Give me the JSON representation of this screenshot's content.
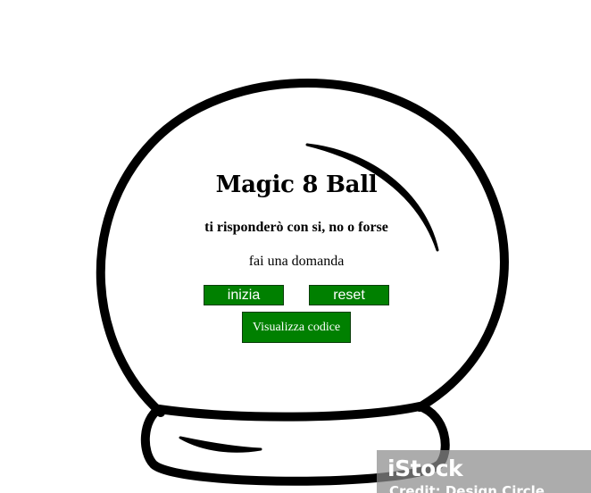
{
  "app": {
    "title": "Magic 8 Ball",
    "subtitle": "ti risponderò con si, no o forse",
    "prompt": "fai una domanda"
  },
  "buttons": {
    "start_label": "inizia",
    "reset_label": "reset",
    "view_code_label": "Visualizza codice"
  },
  "watermark": {
    "logo_text": "iStock",
    "credit_text": "Credit: Design Circle"
  },
  "colors": {
    "button_bg": "#008000",
    "button_text": "#ffffff",
    "outline": "#000000",
    "background": "#ffffff"
  }
}
